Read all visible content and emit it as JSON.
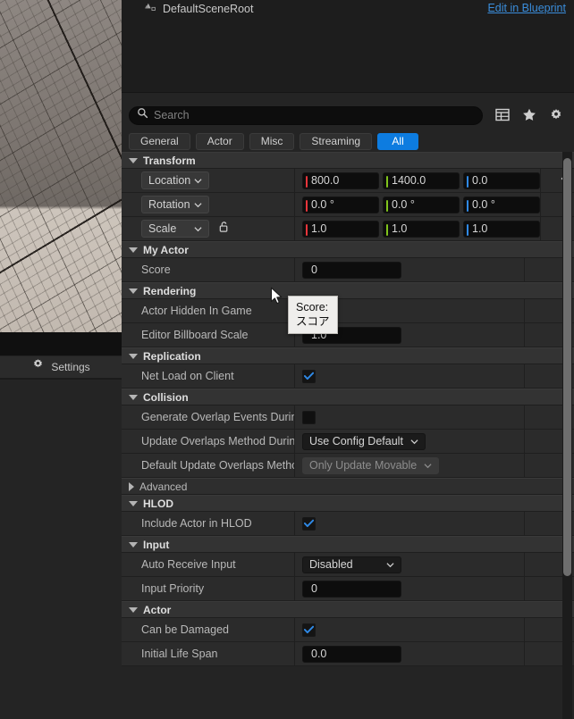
{
  "viewport": {
    "settings_label": "Settings",
    "settings_icon": "gear-icon"
  },
  "components": {
    "root_item": "DefaultSceneRoot",
    "root_icon": "scene-root-icon",
    "edit_in_blueprint": "Edit in Blueprint"
  },
  "search": {
    "placeholder": "Search",
    "value": "",
    "icon": "search-icon"
  },
  "header_icons": [
    {
      "name": "column-layout-icon",
      "label": "Column Layout"
    },
    {
      "name": "star-icon",
      "label": "Favorites"
    },
    {
      "name": "gear-icon",
      "label": "Settings"
    }
  ],
  "filters": [
    {
      "label": "General",
      "active": false
    },
    {
      "label": "Actor",
      "active": false
    },
    {
      "label": "Misc",
      "active": false
    },
    {
      "label": "Streaming",
      "active": false
    },
    {
      "label": "All",
      "active": true
    }
  ],
  "accent_color": "#0d7ce0",
  "axis_colors": {
    "x": "#e8353b",
    "y": "#80c41c",
    "z": "#2f8ae8"
  },
  "sections": {
    "transform": {
      "title": "Transform",
      "expanded": true,
      "location": {
        "label": "Location",
        "x": "800.0",
        "y": "1400.0",
        "z": "0.0",
        "reset_icon": "reset-arrow-icon"
      },
      "rotation": {
        "label": "Rotation",
        "x": "0.0 °",
        "y": "0.0 °",
        "z": "0.0 °"
      },
      "scale": {
        "label": "Scale",
        "x": "1.0",
        "y": "1.0",
        "z": "1.0",
        "lock_icon": "unlocked-padlock-icon"
      }
    },
    "my_actor": {
      "title": "My Actor",
      "expanded": true,
      "score": {
        "label": "Score",
        "value": "0"
      }
    },
    "rendering": {
      "title": "Rendering",
      "expanded": true,
      "actor_hidden_in_game": {
        "label": "Actor Hidden In Game",
        "checked": false
      },
      "editor_billboard_scale": {
        "label": "Editor Billboard Scale",
        "value": "1.0"
      }
    },
    "replication": {
      "title": "Replication",
      "expanded": true,
      "net_load_on_client": {
        "label": "Net Load on Client",
        "checked": true
      }
    },
    "collision": {
      "title": "Collision",
      "expanded": true,
      "generate_overlap_events": {
        "label": "Generate Overlap Events During...",
        "checked": false
      },
      "update_overlaps_method": {
        "label": "Update Overlaps Method During...",
        "value": "Use Config Default"
      },
      "default_update_overlaps_method": {
        "label": "Default Update Overlaps Method...",
        "value": "Only Update Movable",
        "disabled": true
      },
      "advanced": {
        "label": "Advanced",
        "expanded": false
      }
    },
    "hlod": {
      "title": "HLOD",
      "expanded": true,
      "include_actor_in_hlod": {
        "label": "Include Actor in HLOD",
        "checked": true
      }
    },
    "input": {
      "title": "Input",
      "expanded": true,
      "auto_receive_input": {
        "label": "Auto Receive Input",
        "value": "Disabled"
      },
      "input_priority": {
        "label": "Input Priority",
        "value": "0"
      }
    },
    "actor": {
      "title": "Actor",
      "expanded": true,
      "can_be_damaged": {
        "label": "Can be Damaged",
        "checked": true
      },
      "initial_life_span": {
        "label": "Initial Life Span",
        "value": "0.0"
      }
    }
  },
  "tooltip": {
    "line1": "Score:",
    "line2": "スコア"
  }
}
